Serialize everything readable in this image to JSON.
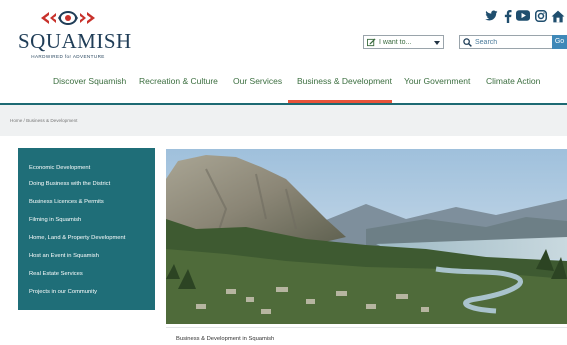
{
  "brand": {
    "name": "SQUAMISH",
    "tagline": "HARDWIRED for ADVENTURE",
    "color": "#1f3d57"
  },
  "social": [
    "twitter-icon",
    "facebook-icon",
    "youtube-icon",
    "instagram-icon",
    "house-icon"
  ],
  "toolbar": {
    "i_want_label": "I want to...",
    "search_placeholder": "Search",
    "search_button": "Go"
  },
  "nav": {
    "items": [
      "Discover Squamish",
      "Recreation & Culture",
      "Our Services",
      "Business & Development",
      "Your Government",
      "Climate Action"
    ],
    "active": "Business & Development",
    "active_color": "#e8533a",
    "text_color": "#3b6e3f"
  },
  "breadcrumb": {
    "home": "Home",
    "separator": "/",
    "current": "Business & Development"
  },
  "sidebar": {
    "color": "#1f6e78",
    "items": [
      "Economic Development",
      "Doing Business with the District",
      "Business Licences & Permits",
      "Filming in Squamish",
      "Home, Land & Property Development",
      "Host an Event in Squamish",
      "Real Estate Services",
      "Projects in our Community"
    ]
  },
  "hero": {
    "caption": "Business & Development in Squamish"
  }
}
